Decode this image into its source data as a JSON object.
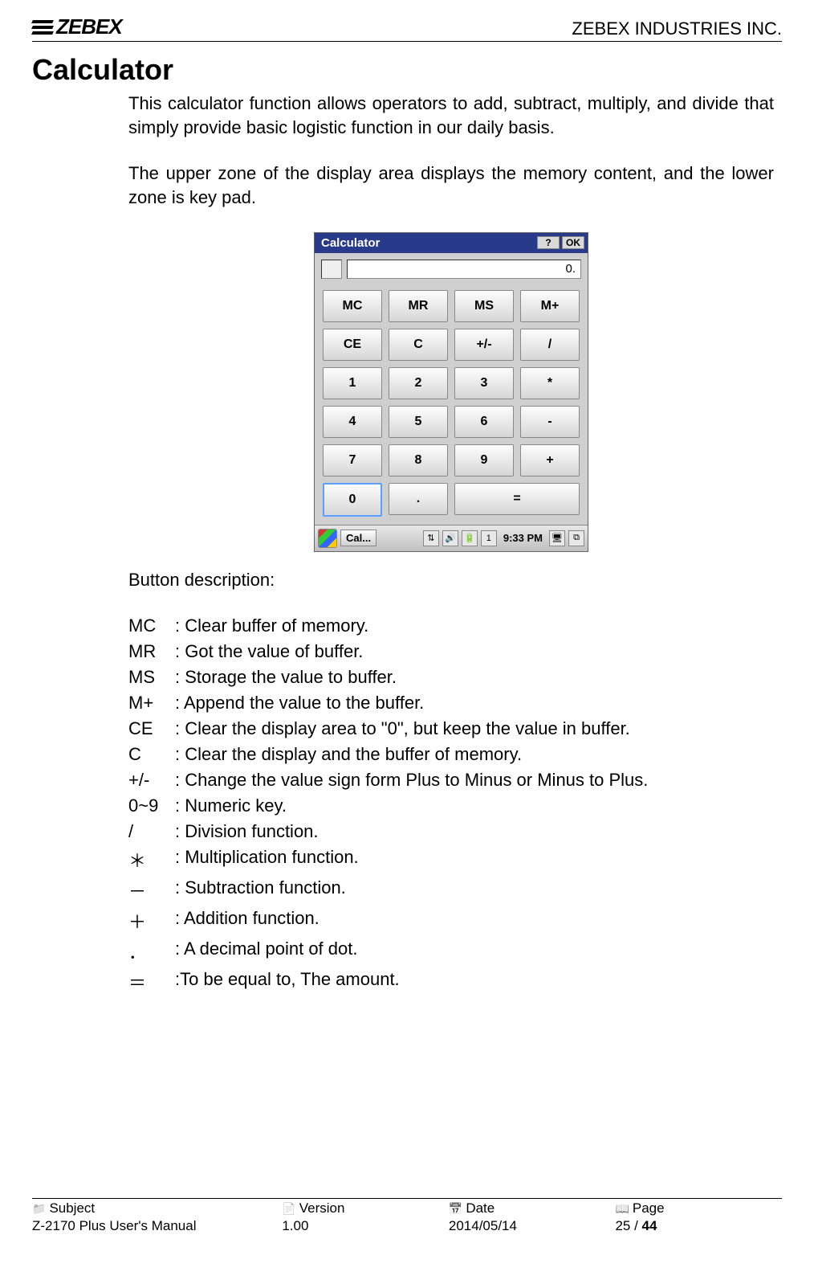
{
  "header": {
    "logo_text": "ZEBEX",
    "company": "ZEBEX INDUSTRIES INC."
  },
  "title": "Calculator",
  "paragraphs": {
    "p1": "This calculator function allows operators to add, subtract, multiply, and divide that simply provide basic logistic function in our daily basis.",
    "p2": "The upper zone of the display area displays the memory content, and the lower zone is key pad."
  },
  "calc": {
    "window_title": "Calculator",
    "help_btn": "?",
    "ok_btn": "OK",
    "display": "0.",
    "keys": {
      "r1": [
        "MC",
        "MR",
        "MS",
        "M+"
      ],
      "r2": [
        "CE",
        "C",
        "+/-",
        "/"
      ],
      "r3": [
        "1",
        "2",
        "3",
        "*"
      ],
      "r4": [
        "4",
        "5",
        "6",
        "-"
      ],
      "r5": [
        "7",
        "8",
        "9",
        "+"
      ],
      "r6": [
        "0",
        ".",
        "="
      ]
    },
    "taskbar": {
      "app_label": "Cal...",
      "tray_num": "1",
      "time": "9:33 PM"
    }
  },
  "desc_label": "Button description:",
  "descriptions": [
    {
      "key": "MC",
      "text": ": Clear buffer of memory."
    },
    {
      "key": "MR",
      "text": ": Got the value of buffer."
    },
    {
      "key": "MS",
      "text": ": Storage the value to buffer."
    },
    {
      "key": "M+",
      "text": ": Append the value to the buffer."
    },
    {
      "key": "CE",
      "text": ": Clear the display area to \"0\", but keep the value in buffer."
    },
    {
      "key": "C",
      "text": ": Clear the display and the buffer of memory."
    },
    {
      "key": "+/-",
      "text": ": Change the value sign form Plus to Minus or Minus to Plus."
    },
    {
      "key": "0~9",
      "text": ": Numeric key."
    },
    {
      "key": "/",
      "text": ": Division function."
    },
    {
      "key": "＊",
      "text": ": Multiplication function."
    },
    {
      "key": "－",
      "text": ": Subtraction function."
    },
    {
      "key": "＋",
      "text": ": Addition function."
    },
    {
      "key": "．",
      "text": ": A decimal point of dot."
    },
    {
      "key": "＝",
      "text": ":To be equal to, The amount."
    }
  ],
  "footer": {
    "subject_label": "Subject",
    "subject_value": "Z-2170 Plus User's Manual",
    "version_label": "Version",
    "version_value": "1.00",
    "date_label": "Date",
    "date_value": "2014/05/14",
    "page_label": "Page",
    "page_current": "25",
    "page_sep": " / ",
    "page_total": "44"
  }
}
